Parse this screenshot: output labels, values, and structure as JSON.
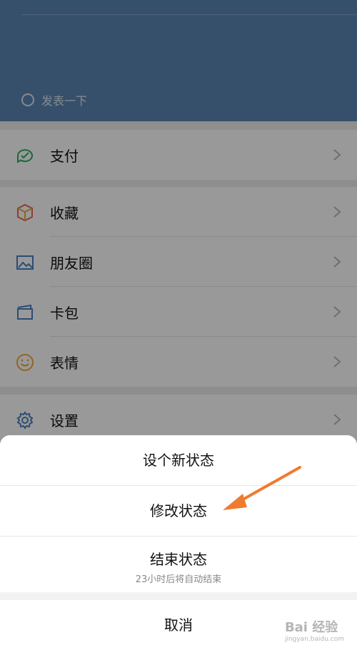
{
  "header": {
    "status_text": "发表一下"
  },
  "menu": {
    "pay": {
      "label": "支付"
    },
    "favorites": {
      "label": "收藏"
    },
    "moments": {
      "label": "朋友圈"
    },
    "cards": {
      "label": "卡包"
    },
    "stickers": {
      "label": "表情"
    },
    "settings": {
      "label": "设置"
    }
  },
  "action_sheet": {
    "set_new_status": "设个新状态",
    "modify_status": "修改状态",
    "end_status": "结束状态",
    "end_status_hint": "23小时后将自动结束",
    "cancel": "取消"
  },
  "watermark": {
    "brand": "Bai 经验",
    "url": "jingyan.baidu.com"
  },
  "colors": {
    "header_bg": "#5b86b4",
    "arrow": "#f07b2e",
    "pay_icon": "#2bae67",
    "accent": "#4a7fc1"
  }
}
